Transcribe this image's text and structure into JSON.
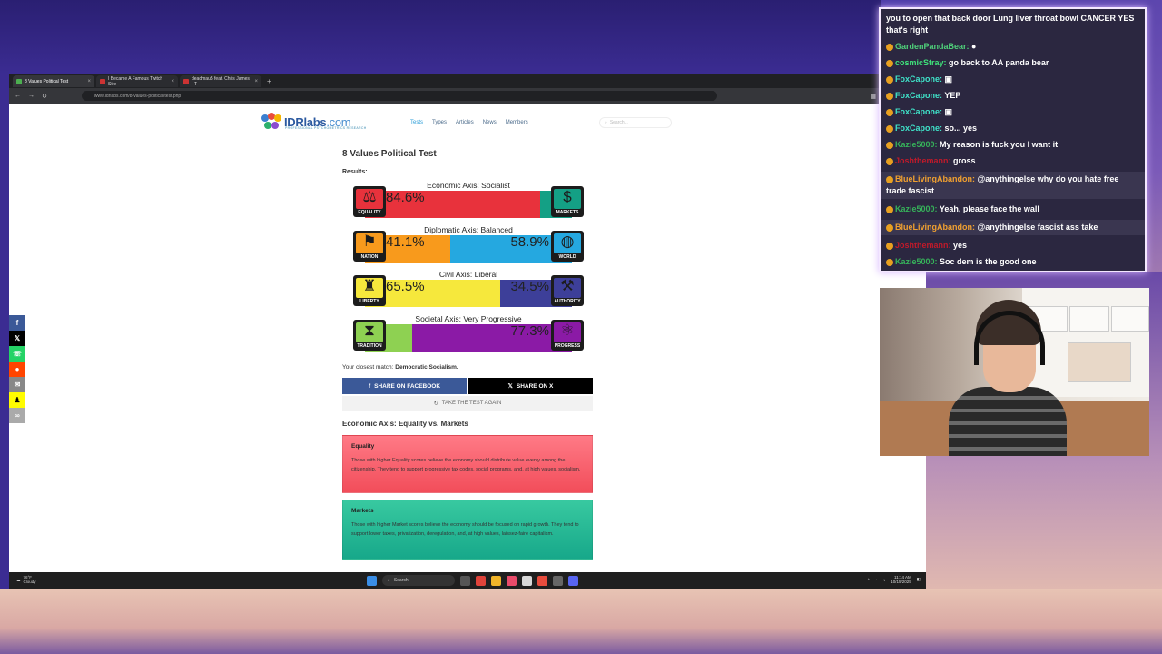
{
  "browser": {
    "tabs": [
      {
        "label": "8 Values Political Test",
        "active": true
      },
      {
        "label": "I Became A Famous Twitch Stre",
        "active": false
      },
      {
        "label": "deadmau5 feat. Chris James - T",
        "active": false
      }
    ],
    "url": "www.idrlabs.com/8-values-political/test.php"
  },
  "site": {
    "logo_main": "IDRlabs",
    "logo_tld": ".com",
    "logo_tagline": "PROFESSIONAL PSYCHOMETRICS RESEARCH",
    "nav": [
      "Tests",
      "Types",
      "Articles",
      "News",
      "Members"
    ],
    "search_placeholder": "Search..."
  },
  "test": {
    "title": "8 Values Political Test",
    "results_label": "Results:",
    "axes": [
      {
        "title": "Economic Axis: Socialist",
        "left_label": "EQUALITY",
        "right_label": "MARKETS",
        "left_pct": "84.6%",
        "right_pct": "",
        "left_value": 84.6,
        "left_color": "#e8323c",
        "right_color": "#14a085",
        "left_icon": "scales-icon",
        "right_icon": "dollar-icon"
      },
      {
        "title": "Diplomatic Axis: Balanced",
        "left_label": "NATION",
        "right_label": "WORLD",
        "left_pct": "41.1%",
        "right_pct": "58.9%",
        "left_value": 41.1,
        "left_color": "#f89a1c",
        "right_color": "#25a8e0",
        "left_icon": "flag-icon",
        "right_icon": "globe-icon"
      },
      {
        "title": "Civil Axis: Liberal",
        "left_label": "LIBERTY",
        "right_label": "AUTHORITY",
        "left_pct": "65.5%",
        "right_pct": "34.5%",
        "left_value": 65.5,
        "left_color": "#f6e83c",
        "right_color": "#3d3f99",
        "left_icon": "statue-icon",
        "right_icon": "gavel-icon"
      },
      {
        "title": "Societal Axis: Very Progressive",
        "left_label": "TRADITION",
        "right_label": "PROGRESS",
        "left_pct": "",
        "right_pct": "77.3%",
        "left_value": 22.7,
        "left_color": "#8ed152",
        "right_color": "#8b1aa6",
        "left_icon": "hourglass-icon",
        "right_icon": "atom-icon"
      }
    ],
    "match_prefix": "Your closest match: ",
    "match_value": "Democratic Socialism.",
    "share_facebook": "SHARE ON FACEBOOK",
    "share_x": "SHARE ON X",
    "take_again": "TAKE THE TEST AGAIN",
    "section_heading": "Economic Axis: Equality vs. Markets",
    "cards": [
      {
        "heading": "Equality",
        "text": "Those with higher Equality scores believe the economy should distribute value evenly among the citizenship. They tend to support progressive tax codes, social programs, and, at high values, socialism."
      },
      {
        "heading": "Markets",
        "text": "Those with higher Market scores believe the economy should be focused on rapid growth. They tend to support lower taxes, privatization, deregulation, and, at high values, laissez-faire capitalism."
      }
    ]
  },
  "taskbar": {
    "weather_temp": "76°F",
    "weather_cond": "Cloudy",
    "search_label": "Search",
    "time": "11:14 AM",
    "date": "10/15/2025"
  },
  "chat": {
    "messages": [
      {
        "user": "",
        "user_color": "#ffffff",
        "text": "you to open that back door Lung liver throat bowl CANCER YES that's right"
      },
      {
        "user": "GardenPandaBear:",
        "user_color": "#4fd07a",
        "text": "●"
      },
      {
        "user": "cosmicStray:",
        "user_color": "#3fe27a",
        "text": "go back to AA panda bear"
      },
      {
        "user": "FoxCapone:",
        "user_color": "#3fe2c8",
        "text": "▣"
      },
      {
        "user": "FoxCapone:",
        "user_color": "#3fe2c8",
        "text": "YEP"
      },
      {
        "user": "FoxCapone:",
        "user_color": "#3fe2c8",
        "text": "▣"
      },
      {
        "user": "FoxCapone:",
        "user_color": "#3fe2c8",
        "text": "so... yes"
      },
      {
        "user": "Kazie5000:",
        "user_color": "#36b25a",
        "text": "My reason is fuck you I want it"
      },
      {
        "user": "Joshthemann:",
        "user_color": "#c01a2a",
        "text": "gross"
      },
      {
        "user": "BlueLivingAbandon:",
        "user_color": "#f0a030",
        "text": "@anythingelse why do you hate free trade fascist"
      },
      {
        "user": "Kazie5000:",
        "user_color": "#36b25a",
        "text": "Yeah, please face the wall"
      },
      {
        "user": "BlueLivingAbandon:",
        "user_color": "#f0a030",
        "text": "@anythingelse fascist ass take"
      },
      {
        "user": "Joshthemann:",
        "user_color": "#c01a2a",
        "text": "yes"
      },
      {
        "user": "Kazie5000:",
        "user_color": "#36b25a",
        "text": "Soc dem is the good one"
      }
    ]
  }
}
